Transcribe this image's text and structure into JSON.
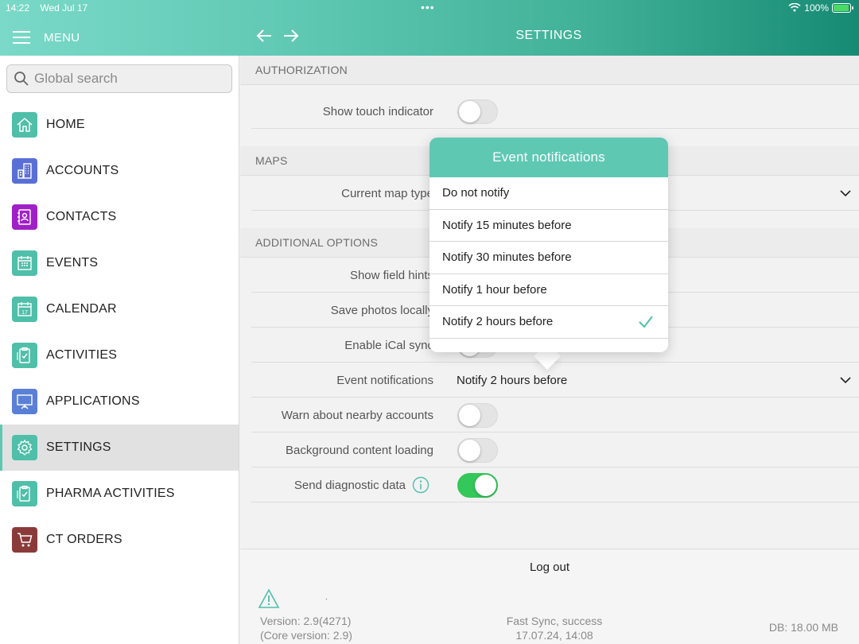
{
  "status_bar": {
    "time": "14:22",
    "date": "Wed Jul 17",
    "battery": "100%"
  },
  "header": {
    "menu_label": "MENU",
    "title": "SETTINGS"
  },
  "sidebar": {
    "search_placeholder": "Global search",
    "items": [
      {
        "label": "HOME",
        "icon": "home-icon",
        "color": "#4fbfa9"
      },
      {
        "label": "ACCOUNTS",
        "icon": "building-icon",
        "color": "#5a6fd6"
      },
      {
        "label": "CONTACTS",
        "icon": "contact-book-icon",
        "color": "#a020c8"
      },
      {
        "label": "EVENTS",
        "icon": "calendar-grid-icon",
        "color": "#4fbfa9"
      },
      {
        "label": "CALENDAR",
        "icon": "calendar-17-icon",
        "color": "#4fbfa9"
      },
      {
        "label": "ACTIVITIES",
        "icon": "clipboard-check-icon",
        "color": "#4fbfa9"
      },
      {
        "label": "APPLICATIONS",
        "icon": "presentation-icon",
        "color": "#5a7fd6"
      },
      {
        "label": "SETTINGS",
        "icon": "gear-icon",
        "color": "#4fbfa9",
        "active": true
      },
      {
        "label": "PHARMA ACTIVITIES",
        "icon": "clipboard-check-icon",
        "color": "#4fbfa9"
      },
      {
        "label": "CT ORDERS",
        "icon": "cart-icon",
        "color": "#8b3a3a"
      }
    ]
  },
  "sections": {
    "authorization": "AUTHORIZATION",
    "maps": "MAPS",
    "additional": "ADDITIONAL OPTIONS"
  },
  "settings": {
    "show_touch_indicator": {
      "label": "Show touch indicator",
      "on": false
    },
    "current_map_type": {
      "label": "Current map type",
      "value": ""
    },
    "show_field_hints": {
      "label": "Show field hints"
    },
    "save_photos_locally": {
      "label": "Save photos locally"
    },
    "enable_ical_sync": {
      "label": "Enable iCal sync",
      "on": false
    },
    "event_notifications": {
      "label": "Event notifications",
      "value": "Notify 2 hours before"
    },
    "warn_nearby": {
      "label": "Warn about nearby accounts",
      "on": false
    },
    "background_loading": {
      "label": "Background content loading",
      "on": false
    },
    "send_diagnostic": {
      "label": "Send diagnostic data",
      "on": true
    }
  },
  "popup": {
    "title": "Event notifications",
    "options": [
      "Do not notify",
      "Notify 15 minutes before",
      "Notify 30 minutes before",
      "Notify 1 hour before",
      "Notify 2 hours before"
    ],
    "selected": "Notify 2 hours before"
  },
  "footer": {
    "logout": "Log out",
    "version": "Version: 2.9(4271)",
    "core_version": "(Core version: 2.9)",
    "sync_status": "Fast Sync, success",
    "sync_time": "17.07.24, 14:08",
    "db_size": "DB: 18.00 MB"
  }
}
